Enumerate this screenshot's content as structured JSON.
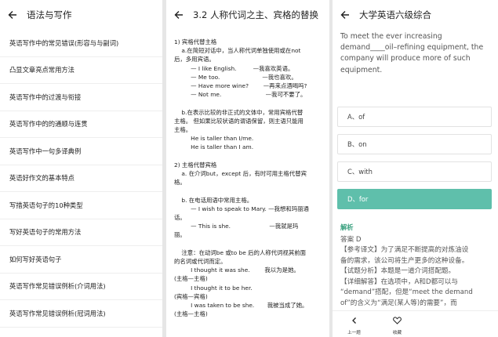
{
  "panel1": {
    "title": "语法与写作",
    "items": [
      "英语写作中的常见错误(形容与与副词)",
      "凸显文章亮点常用方法",
      "英语写作中的过渡与衔接",
      "英语写作中的的通顺与连贯",
      "英语写作中一句多译典例",
      "英语好作文的基本特点",
      "写措英语句子的10种类型",
      "写好英语句子的常用方法",
      "如何写好英语句子",
      "英语写作常见错误例析(介词用法)",
      "英语写作常见错误例析(冠词用法)"
    ]
  },
  "panel2": {
    "title": "3.2 人称代词之主、宾格的替换",
    "lines": [
      "1) 宾格代替主格",
      "    a.在简短对话中，当人称代词单独使用或在not",
      "后，多用宾语。",
      "         — I like English.         —我喜欢英语。",
      "         — Me too.                       —我也喜欢。",
      "         — Have more wine?        —再来点酒喝吗?",
      "         — Not me.                        —我可不要了。",
      "",
      "    b.在表示比较的非正式的文体中，常用宾格代替",
      "主格。 但如果比较状语的谓语保留，则主语只能用",
      "主格。",
      "         He is taller than I/me.",
      "         He is taller than I am.",
      "",
      "2) 主格代替宾格",
      "    a. 在介词but，except 后，有时可用主格代替宾",
      "格。",
      "",
      "    b. 在电话用语中常用主格。",
      "         — I wish to speak to Mary. —我想和玛丽通",
      "话。",
      "         — This is she.                     —我就是玛",
      "丽。",
      "",
      "    注意：在动词be 或to be 后的人称代词视其前面",
      "的名词或代词而定。",
      "         I thought it was she.        我以为是她。",
      "(主格—主格)",
      "         I thought it to be her.",
      "(宾格—宾格)",
      "         I was taken to be she.       我被当成了她。",
      "(主格—主格)"
    ]
  },
  "panel3": {
    "title": "大学英语六级综合",
    "question": "To meet the ever increasing demand____oil–refining equipment, the company will produce more of such equipment.",
    "options": [
      "A、of",
      "B、on",
      "C、with",
      "D、for"
    ],
    "selected_index": 3,
    "analysis_title": "解析",
    "answer": "答案 D",
    "analysis_lines": [
      "【参考译文】为了满足不断提高的对炼油设",
      "备的需求，该公司将生产更多的这种设备。",
      "【试题分析】本题是一道介词搭配题。",
      "【详细解答】在选项中，A和D都可以与",
      "“demand”搭配，但是“meet the demand",
      "of”的含义为“满足(某人等)的需要”，而"
    ],
    "prev_label": "上一题",
    "fav_label": "收藏"
  },
  "colors": {
    "accent": "#5fbfab",
    "analysis_title": "#3aa07f"
  }
}
